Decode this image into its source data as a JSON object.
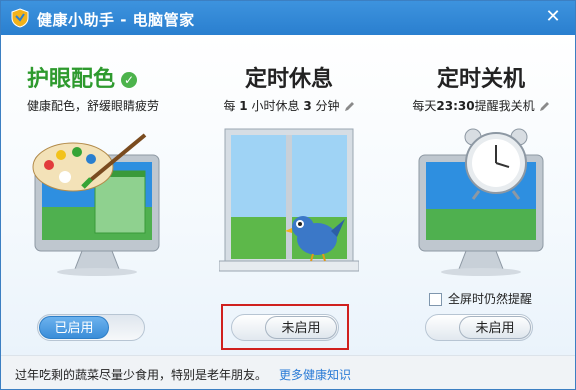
{
  "window": {
    "title": "健康小助手 - 电脑管家",
    "close_icon": "close-icon"
  },
  "columns": [
    {
      "title": "护眼配色",
      "status_icon": "check-circle-icon",
      "subtitle": "健康配色，舒缓眼睛疲劳",
      "toggle_label": "已启用",
      "toggle_state": "on"
    },
    {
      "title": "定时休息",
      "subtitle_prefix": "每",
      "interval_value": "1",
      "subtitle_mid": "小时休息",
      "rest_value": "3",
      "subtitle_suffix": "分钟",
      "toggle_label": "未启用",
      "toggle_state": "off"
    },
    {
      "title": "定时关机",
      "subtitle_prefix": "每天",
      "time_value": "23:30",
      "subtitle_suffix": "提醒我关机",
      "fullscreen_label": "全屏时仍然提醒",
      "fullscreen_checked": false,
      "toggle_label": "未启用",
      "toggle_state": "off"
    }
  ],
  "footer": {
    "tip": "过年吃剩的蔬菜尽量少食用，特别是老年朋友。",
    "more_link": "更多健康知识"
  },
  "colors": {
    "titlebar": "#2f86d6",
    "accent_green": "#2e9a2e",
    "link_blue": "#2a7bd6",
    "highlight_red": "#d0201e"
  }
}
